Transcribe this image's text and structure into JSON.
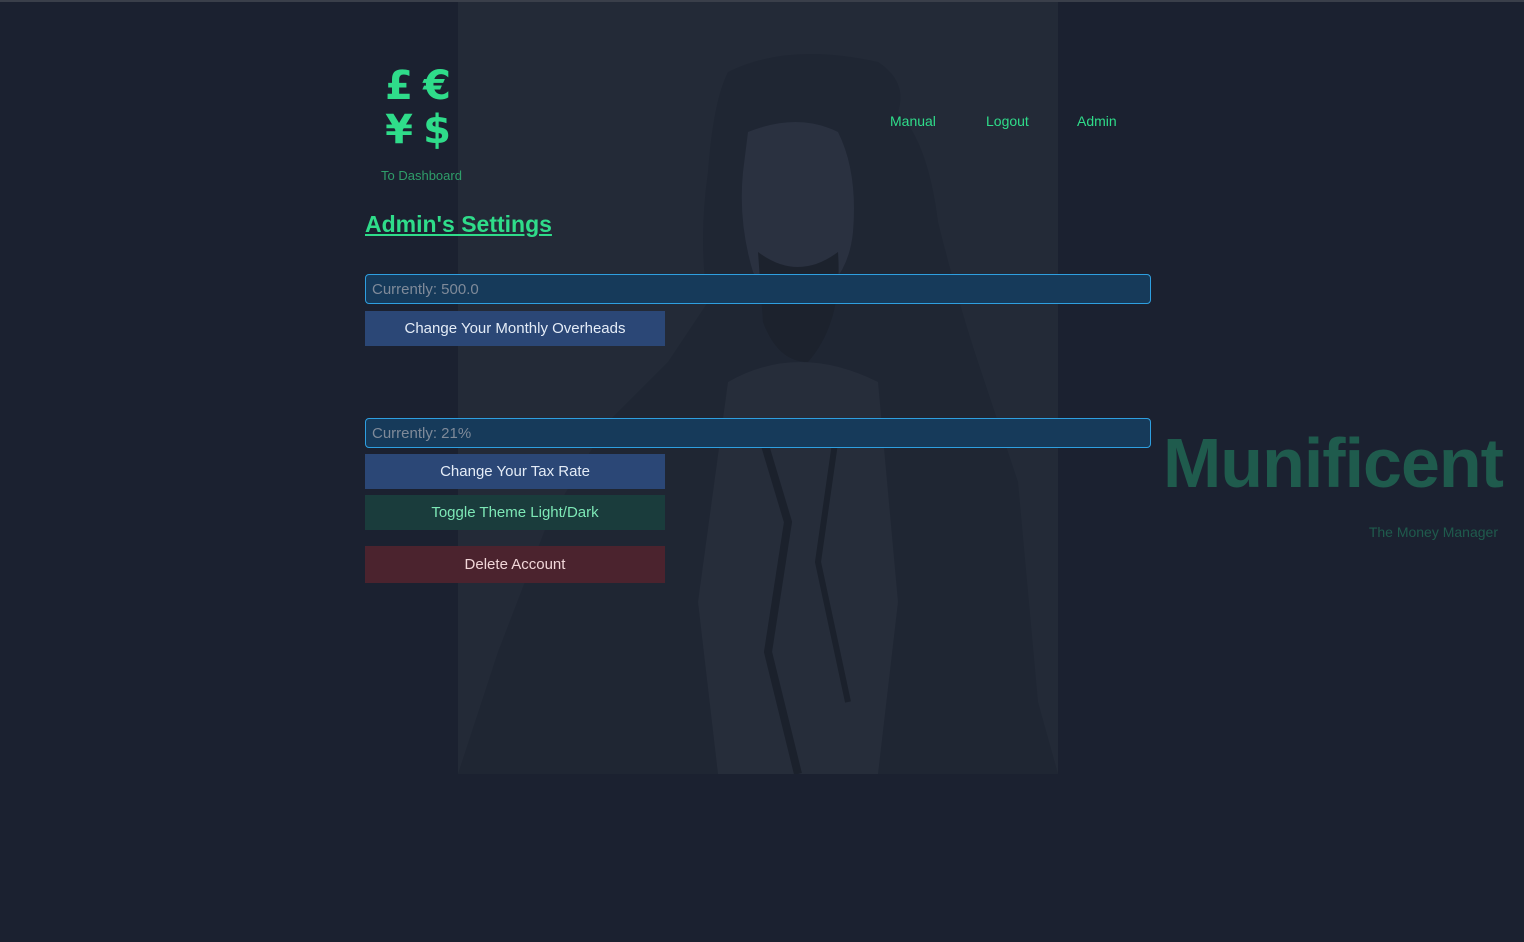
{
  "logo": {
    "glyphs": [
      "£",
      "€",
      "¥",
      "$"
    ],
    "link_label": "To Dashboard"
  },
  "nav": {
    "manual": "Manual",
    "logout": "Logout",
    "admin": "Admin"
  },
  "page": {
    "title": "Admin's Settings"
  },
  "overheads": {
    "placeholder": "Currently: 500.0",
    "button_label": "Change Your Monthly Overheads"
  },
  "tax": {
    "placeholder": "Currently: 21%",
    "button_label": "Change Your Tax Rate"
  },
  "theme": {
    "button_label": "Toggle Theme Light/Dark"
  },
  "account": {
    "delete_label": "Delete Account"
  },
  "brand": {
    "name": "Munificent",
    "tagline": "The Money Manager"
  },
  "colors": {
    "accent": "#2fdc8a",
    "background": "#1b2130",
    "button_blue": "#2b4776",
    "button_green": "#1a3c3c",
    "button_red": "#4b232e",
    "input_border": "#2e9fe0",
    "brand_text": "#1f5b4d"
  }
}
